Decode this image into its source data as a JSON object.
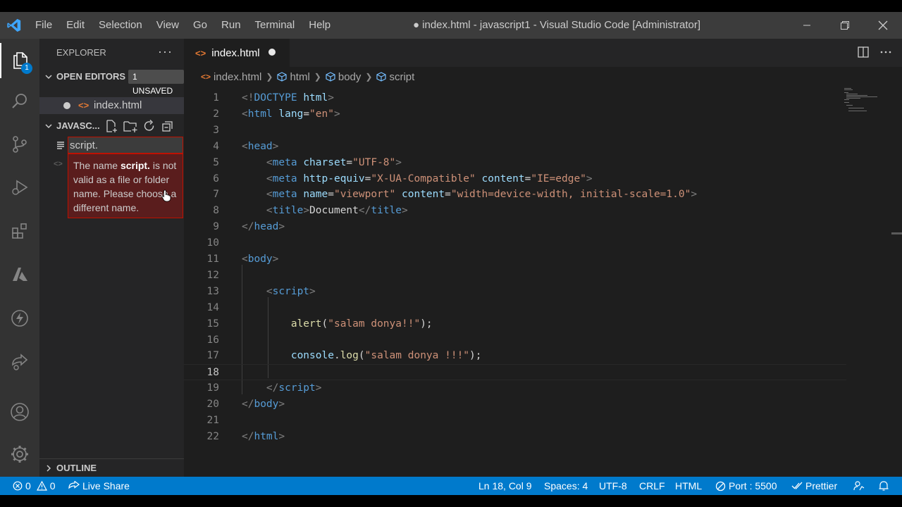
{
  "window": {
    "title": "● index.html - javascript1 - Visual Studio Code [Administrator]",
    "menu": [
      "File",
      "Edit",
      "Selection",
      "View",
      "Go",
      "Run",
      "Terminal",
      "Help"
    ]
  },
  "activity": {
    "explorer_badge": "1",
    "icons": [
      "files-icon",
      "search-icon",
      "source-control-icon",
      "run-debug-icon",
      "extensions-icon",
      "azure-icon",
      "lightning-icon",
      "live-share-icon",
      "account-icon",
      "settings-gear-icon"
    ]
  },
  "sidebar": {
    "title": "EXPLORER",
    "more": "···",
    "open_editors": {
      "label": "OPEN EDITORS",
      "badge": "1 UNSAVED",
      "file": "index.html"
    },
    "folder": {
      "label": "JAVASC..."
    },
    "rename": {
      "value": "script."
    },
    "error": {
      "pre": "The name ",
      "name": "script.",
      "post": " is not valid as a file or folder name. Please choose a different name."
    },
    "outline": "OUTLINE"
  },
  "editor": {
    "tab": {
      "label": "index.html"
    },
    "breadcrumbs": [
      "index.html",
      "html",
      "body",
      "script"
    ],
    "lines": [
      [
        [
          "t",
          "<!"
        ],
        [
          "tn",
          "DOCTYPE"
        ],
        [
          "tx",
          " "
        ],
        [
          "an",
          "html"
        ],
        [
          "t",
          ">"
        ]
      ],
      [
        [
          "t",
          "<"
        ],
        [
          "tn",
          "html"
        ],
        [
          "tx",
          " "
        ],
        [
          "an",
          "lang"
        ],
        [
          "tx",
          "="
        ],
        [
          "av",
          "\"en\""
        ],
        [
          "t",
          ">"
        ]
      ],
      [],
      [
        [
          "t",
          "<"
        ],
        [
          "tn",
          "head"
        ],
        [
          "t",
          ">"
        ]
      ],
      [
        [
          "tx",
          "    "
        ],
        [
          "t",
          "<"
        ],
        [
          "tn",
          "meta"
        ],
        [
          "tx",
          " "
        ],
        [
          "an",
          "charset"
        ],
        [
          "tx",
          "="
        ],
        [
          "av",
          "\"UTF-8\""
        ],
        [
          "t",
          ">"
        ]
      ],
      [
        [
          "tx",
          "    "
        ],
        [
          "t",
          "<"
        ],
        [
          "tn",
          "meta"
        ],
        [
          "tx",
          " "
        ],
        [
          "an",
          "http-equiv"
        ],
        [
          "tx",
          "="
        ],
        [
          "av",
          "\"X-UA-Compatible\""
        ],
        [
          "tx",
          " "
        ],
        [
          "an",
          "content"
        ],
        [
          "tx",
          "="
        ],
        [
          "av",
          "\"IE=edge\""
        ],
        [
          "t",
          ">"
        ]
      ],
      [
        [
          "tx",
          "    "
        ],
        [
          "t",
          "<"
        ],
        [
          "tn",
          "meta"
        ],
        [
          "tx",
          " "
        ],
        [
          "an",
          "name"
        ],
        [
          "tx",
          "="
        ],
        [
          "av",
          "\"viewport\""
        ],
        [
          "tx",
          " "
        ],
        [
          "an",
          "content"
        ],
        [
          "tx",
          "="
        ],
        [
          "av",
          "\"width=device-width, initial-scale=1.0\""
        ],
        [
          "t",
          ">"
        ]
      ],
      [
        [
          "tx",
          "    "
        ],
        [
          "t",
          "<"
        ],
        [
          "tn",
          "title"
        ],
        [
          "t",
          ">"
        ],
        [
          "tx",
          "Document"
        ],
        [
          "t",
          "</"
        ],
        [
          "tn",
          "title"
        ],
        [
          "t",
          ">"
        ]
      ],
      [
        [
          "t",
          "</"
        ],
        [
          "tn",
          "head"
        ],
        [
          "t",
          ">"
        ]
      ],
      [],
      [
        [
          "t",
          "<"
        ],
        [
          "tn",
          "body"
        ],
        [
          "t",
          ">"
        ]
      ],
      [],
      [
        [
          "tx",
          "    "
        ],
        [
          "t",
          "<"
        ],
        [
          "tn",
          "script"
        ],
        [
          "t",
          ">"
        ]
      ],
      [],
      [
        [
          "tx",
          "        "
        ],
        [
          "fn",
          "alert"
        ],
        [
          "tx",
          "("
        ],
        [
          "av",
          "\"salam donya!!\""
        ],
        [
          "tx",
          ");"
        ]
      ],
      [],
      [
        [
          "tx",
          "        "
        ],
        [
          "vr",
          "console"
        ],
        [
          "tx",
          "."
        ],
        [
          "fn",
          "log"
        ],
        [
          "tx",
          "("
        ],
        [
          "av",
          "\"salam donya !!!\""
        ],
        [
          "tx",
          ");"
        ]
      ],
      [],
      [
        [
          "tx",
          "    "
        ],
        [
          "t",
          "</"
        ],
        [
          "tn",
          "script"
        ],
        [
          "t",
          ">"
        ]
      ],
      [
        [
          "t",
          "</"
        ],
        [
          "tn",
          "body"
        ],
        [
          "t",
          ">"
        ]
      ],
      [],
      [
        [
          "t",
          "</"
        ],
        [
          "tn",
          "html"
        ],
        [
          "t",
          ">"
        ]
      ]
    ],
    "current_line": 18
  },
  "statusbar": {
    "errors": "0",
    "warnings": "0",
    "live_share": "Live Share",
    "position": "Ln 18, Col 9",
    "spaces": "Spaces: 4",
    "encoding": "UTF-8",
    "eol": "CRLF",
    "language": "HTML",
    "port": "Port : 5500",
    "prettier": "Prettier"
  },
  "colors": {
    "accent": "#007acc",
    "error_border": "#be1100",
    "error_bg": "#5a1d1d"
  }
}
